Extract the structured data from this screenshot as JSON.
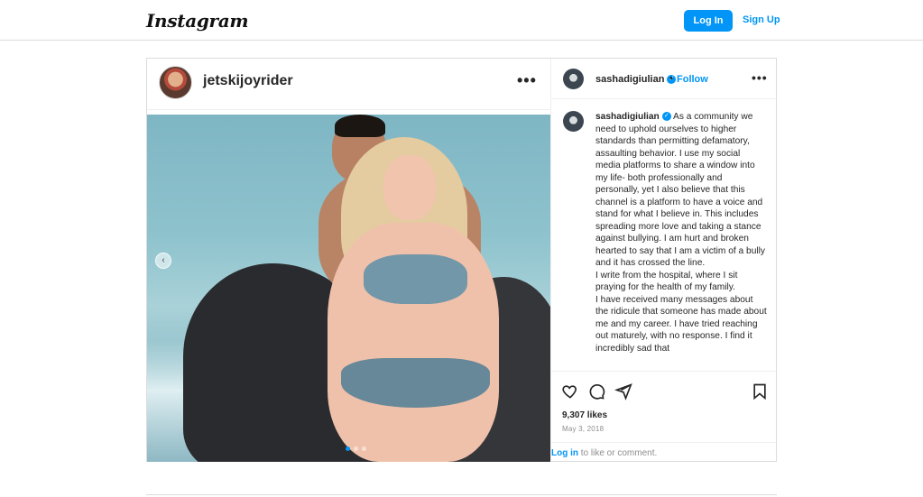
{
  "header": {
    "logo_text": "Instagram",
    "login_label": "Log In",
    "signup_label": "Sign Up"
  },
  "post": {
    "author_username": "jetskijoyrider",
    "more_glyph": "•••",
    "carousel_prev_glyph": "‹",
    "carousel_total": 3,
    "carousel_active": 1
  },
  "side": {
    "username": "sashadigiulian",
    "verified_glyph": "✓",
    "separator": "•",
    "follow_label": "Follow",
    "more_glyph": "•••",
    "caption_username": "sashadigiulian",
    "caption_text": "As a community we need to uphold ourselves to higher standards than permitting defamatory, assaulting behavior. I use my social media platforms to share a window into my life- both professionally and personally, yet I also believe that this channel is a platform to have a voice and stand for what I believe in. This includes spreading more love and taking a stance against bullying. I am hurt and broken hearted to say that I am a victim of a bully and it has crossed the line.",
    "caption_para2": "I write from the hospital, where I sit praying for the health of my family.",
    "caption_para3": "I have received many messages about the ridicule that someone has made about me and my career. I have tried reaching out maturely, with no response. I find it incredibly sad that",
    "likes": "9,307 likes",
    "date": "May 3, 2018",
    "login_link": "Log in",
    "login_suffix": " to like or comment."
  },
  "icons": {
    "like": "heart-icon",
    "comment": "comment-icon",
    "share": "share-icon",
    "save": "bookmark-icon"
  },
  "colors": {
    "accent": "#0095f6",
    "border": "#dbdbdb",
    "text": "#262626",
    "muted": "#8e8e8e"
  }
}
